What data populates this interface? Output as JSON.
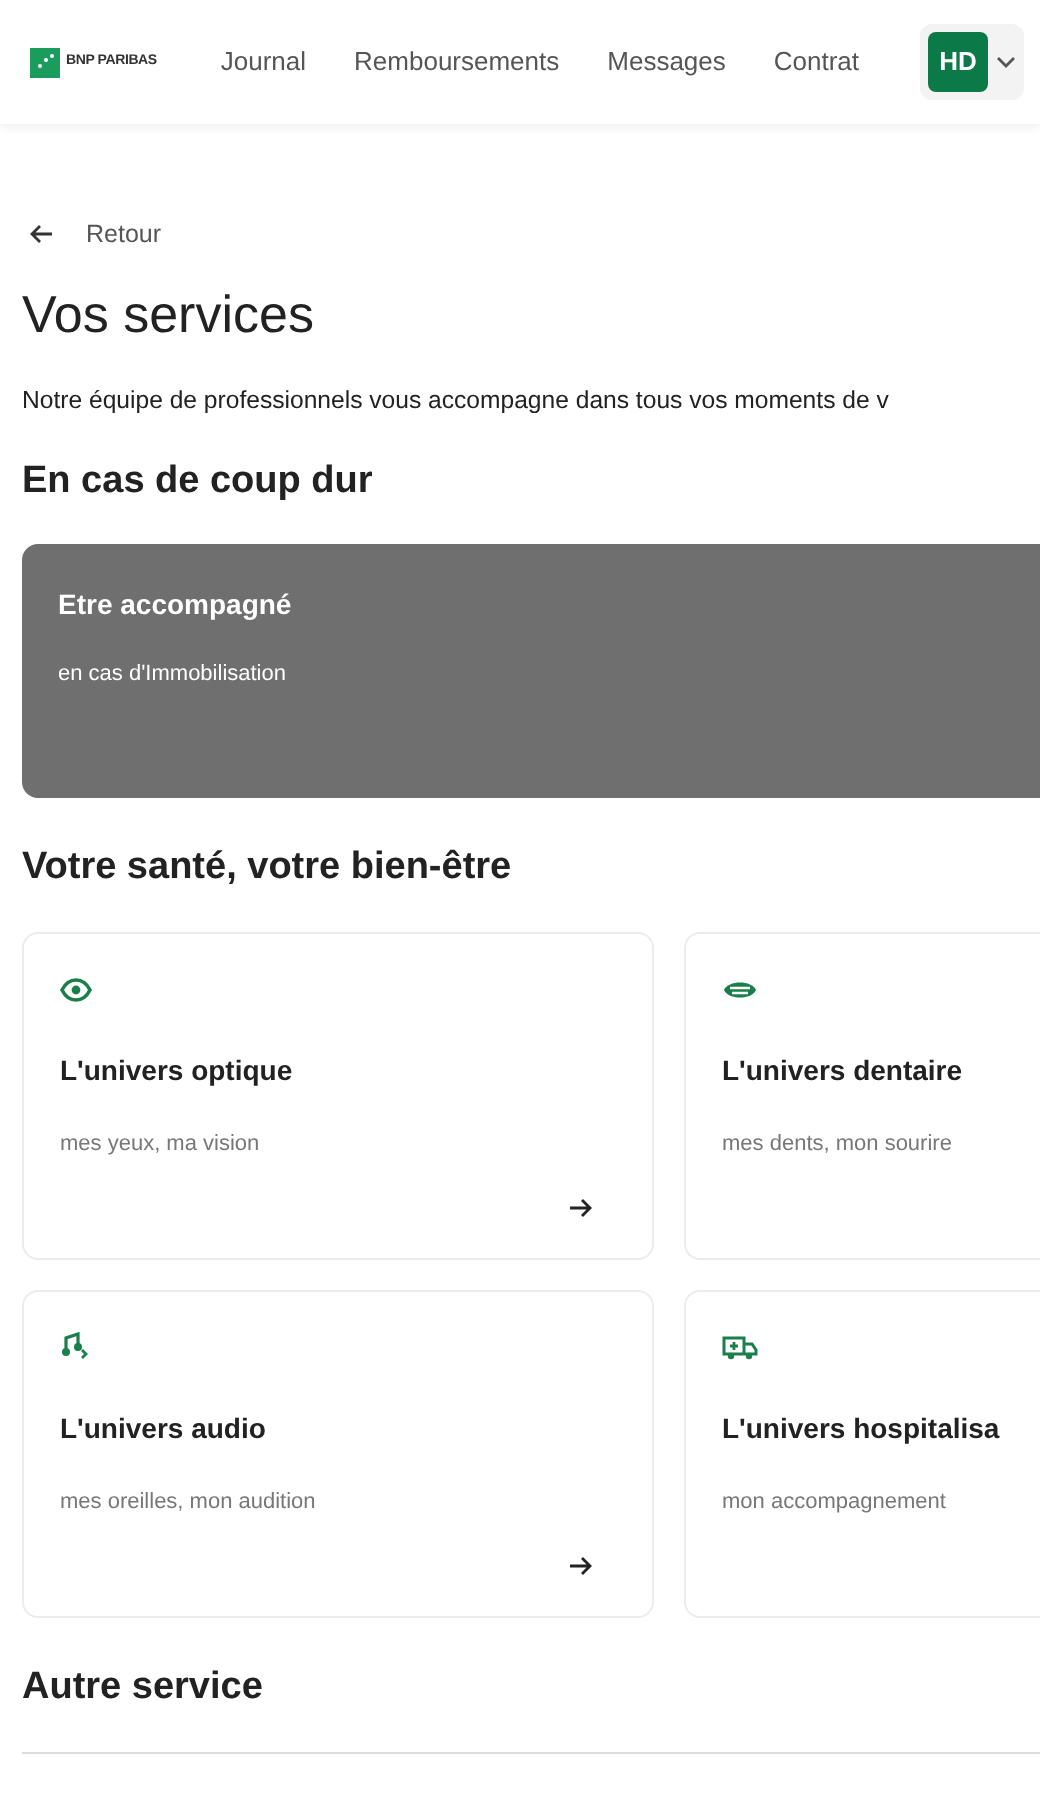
{
  "header": {
    "logo_text": "BNP PARIBAS",
    "nav": [
      {
        "label": "Journal",
        "selected": false
      },
      {
        "label": "Remboursements",
        "selected": false
      },
      {
        "label": "Messages",
        "selected": false
      },
      {
        "label": "Contrat",
        "selected": false
      }
    ],
    "avatar": "HD"
  },
  "back_link": "Retour",
  "title": "Vos services",
  "intro": "Notre équipe de professionnels vous accompagne dans tous vos moments de v",
  "sections": [
    {
      "heading": "En cas de coup dur",
      "kind": "banner",
      "items": [
        {
          "title": "Etre accompagné",
          "subtitle": "en cas d'Immobilisation"
        }
      ]
    },
    {
      "heading": "Votre santé, votre bien-être",
      "kind": "cards",
      "items": [
        {
          "title": "L'univers optique",
          "subtitle": "mes yeux, ma vision",
          "arrow": true
        },
        {
          "title": "L'univers dentaire",
          "subtitle": "mes dents, mon sourire",
          "arrow": false
        },
        {
          "title": "L'univers audio",
          "subtitle": "mes oreilles, mon audition",
          "arrow": true
        },
        {
          "title": "L'univers hospitalisa",
          "subtitle": "mon accompagnement",
          "arrow": false
        }
      ]
    },
    {
      "heading": "Autre service",
      "kind": "list"
    }
  ]
}
